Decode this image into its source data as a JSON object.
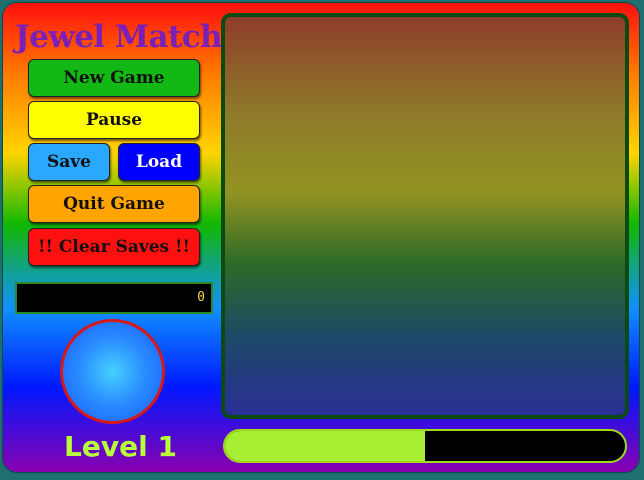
{
  "app": {
    "title": "Jewel Match"
  },
  "buttons": {
    "new_game": "New Game",
    "pause": "Pause",
    "save": "Save",
    "load": "Load",
    "quit_game": "Quit Game",
    "clear_saves": "!! Clear Saves !!"
  },
  "status": {
    "score": "0",
    "level": "Level 1",
    "progress_fraction": 0.5
  },
  "colors": {
    "title": "#7a1fb7",
    "new_game_button": "#14b814",
    "pause_button": "#ffff00",
    "save_button": "#2aa8ff",
    "load_button": "#0000ff",
    "quit_button": "#ffa400",
    "clear_saves_button": "#ff1010",
    "level_text": "#b8ff3a",
    "progress_fill": "#a8ee32"
  },
  "icons": {
    "orb": "blue-orb-icon"
  }
}
